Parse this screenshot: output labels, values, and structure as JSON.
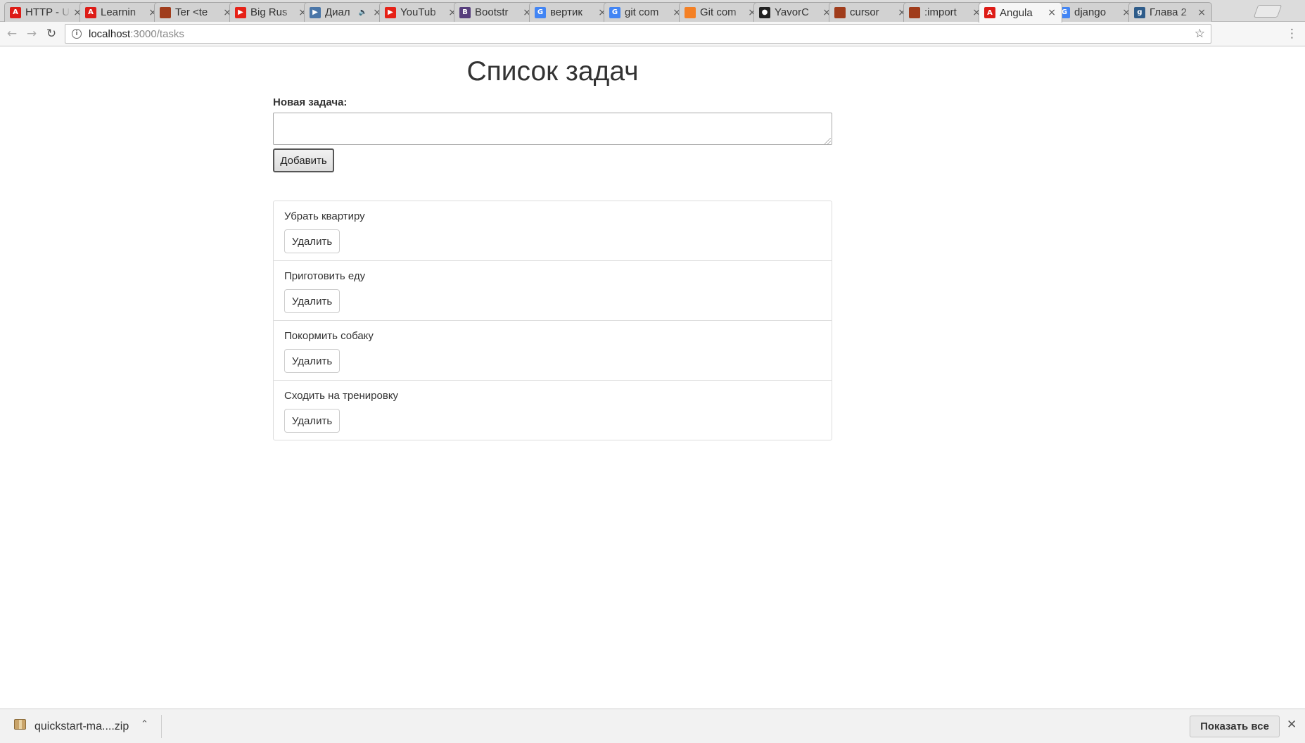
{
  "browser": {
    "tabs": [
      {
        "title": "HTTP - U",
        "icon": "angular-icon",
        "color": "#dd1b16",
        "glyph": "A",
        "active": false
      },
      {
        "title": "Learnin",
        "icon": "angular-icon",
        "color": "#dd1b16",
        "glyph": "A",
        "active": false
      },
      {
        "title": "Ter <te",
        "icon": "stackexchange-icon",
        "color": "#a03c1b",
        "glyph": "",
        "active": false
      },
      {
        "title": "Big Rus",
        "icon": "youtube-icon",
        "color": "#e62117",
        "glyph": "▶",
        "active": false
      },
      {
        "title": "Диал",
        "icon": "video-icon",
        "color": "#4a76a8",
        "glyph": "▶",
        "active": false,
        "audio": true
      },
      {
        "title": "YouTub",
        "icon": "youtube-icon",
        "color": "#e62117",
        "glyph": "▶",
        "active": false
      },
      {
        "title": "Bootstr",
        "icon": "bootstrap-icon",
        "color": "#563d7c",
        "glyph": "B",
        "active": false
      },
      {
        "title": "вертик",
        "icon": "google-icon",
        "color": "#4285f4",
        "glyph": "G",
        "active": false
      },
      {
        "title": "git com",
        "icon": "google-icon",
        "color": "#4285f4",
        "glyph": "G",
        "active": false
      },
      {
        "title": "Git com",
        "icon": "stackoverflow-icon",
        "color": "#f48024",
        "glyph": "",
        "active": false
      },
      {
        "title": "YavorC",
        "icon": "github-icon",
        "color": "#222222",
        "glyph": "●",
        "active": false
      },
      {
        "title": "cursor",
        "icon": "stackexchange-icon",
        "color": "#a03c1b",
        "glyph": "",
        "active": false
      },
      {
        "title": ":import",
        "icon": "stackexchange-icon",
        "color": "#a03c1b",
        "glyph": "",
        "active": false
      },
      {
        "title": "Angula",
        "icon": "angular-icon",
        "color": "#dd1b16",
        "glyph": "A",
        "active": true
      },
      {
        "title": "django",
        "icon": "google-icon",
        "color": "#4285f4",
        "glyph": "G",
        "active": false
      },
      {
        "title": "Глава 2",
        "icon": "doc-icon",
        "color": "#2e5c8a",
        "glyph": "g",
        "active": false
      }
    ],
    "url_host": "localhost",
    "url_path": ":3000/tasks"
  },
  "page": {
    "title": "Список задач",
    "new_task_label": "Новая задача:",
    "new_task_value": "",
    "add_button_label": "Добавить",
    "tasks": [
      {
        "text": "Убрать квартиру",
        "delete_label": "Удалить"
      },
      {
        "text": "Приготовить еду",
        "delete_label": "Удалить"
      },
      {
        "text": "Покормить собаку",
        "delete_label": "Удалить"
      },
      {
        "text": "Сходить на тренировку",
        "delete_label": "Удалить"
      }
    ]
  },
  "downloads": {
    "file_name": "quickstart-ma....zip",
    "show_all_label": "Показать все"
  }
}
